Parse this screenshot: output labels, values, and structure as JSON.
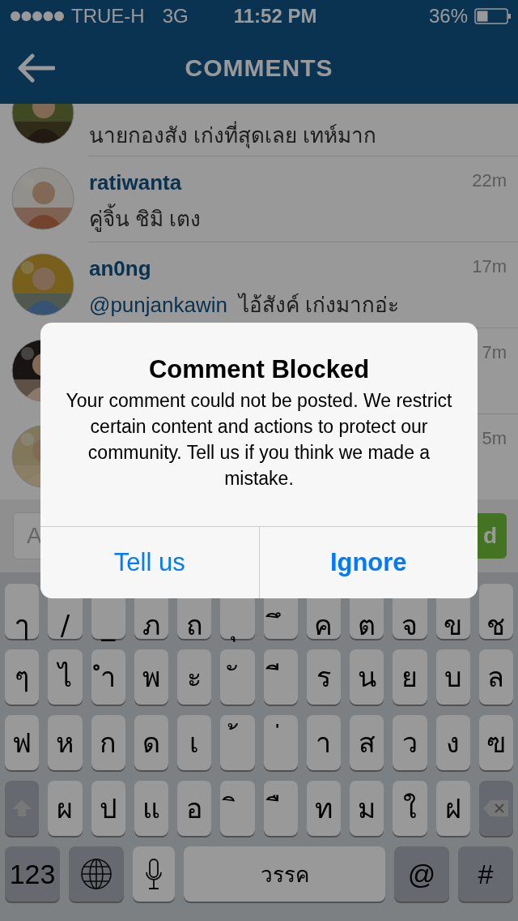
{
  "status_bar": {
    "carrier": "TRUE-H",
    "network": "3G",
    "time": "11:52 PM",
    "battery": "36%"
  },
  "header": {
    "title": "COMMENTS"
  },
  "comments": [
    {
      "text": "นายกองสัง เก่งที่สุดเลย  เทห์มาก"
    },
    {
      "username": "ratiwanta",
      "text": "คู่จิ้น ชิมิ เตง",
      "time": "22m"
    },
    {
      "username": "an0ng",
      "mention": "@punjankawin",
      "text": "ไอ้สังค์ เก่งมากอ่ะ",
      "time": "17m"
    },
    {
      "time": "7m"
    },
    {
      "time": "5m"
    }
  ],
  "composer": {
    "placeholder": "A",
    "send": "d"
  },
  "alert": {
    "title": "Comment Blocked",
    "message": "Your comment could not be posted. We restrict certain content and actions to protect our community. Tell us if you think we made a mistake.",
    "buttons": [
      {
        "label": "Tell us",
        "bold": false
      },
      {
        "label": "Ignore",
        "bold": true
      }
    ]
  },
  "keyboard": {
    "rows": [
      [
        {
          "kind": "letter",
          "label": "ๅ"
        },
        {
          "kind": "letter",
          "label": "/"
        },
        {
          "kind": "letter",
          "label": "_"
        },
        {
          "kind": "letter",
          "label": "ภ"
        },
        {
          "kind": "letter",
          "label": "ถ"
        },
        {
          "kind": "letter",
          "label": "ุ"
        },
        {
          "kind": "letter",
          "label": "ึ"
        },
        {
          "kind": "letter",
          "label": "ค"
        },
        {
          "kind": "letter",
          "label": "ต"
        },
        {
          "kind": "letter",
          "label": "จ"
        },
        {
          "kind": "letter",
          "label": "ข"
        },
        {
          "kind": "letter",
          "label": "ช"
        }
      ],
      [
        {
          "kind": "letter",
          "label": "ๆ"
        },
        {
          "kind": "letter",
          "label": "ไ"
        },
        {
          "kind": "letter",
          "label": "ำ"
        },
        {
          "kind": "letter",
          "label": "พ"
        },
        {
          "kind": "letter",
          "label": "ะ"
        },
        {
          "kind": "letter",
          "label": "ั"
        },
        {
          "kind": "letter",
          "label": "ี"
        },
        {
          "kind": "letter",
          "label": "ร"
        },
        {
          "kind": "letter",
          "label": "น"
        },
        {
          "kind": "letter",
          "label": "ย"
        },
        {
          "kind": "letter",
          "label": "บ"
        },
        {
          "kind": "letter",
          "label": "ล"
        }
      ],
      [
        {
          "kind": "letter",
          "label": "ฟ"
        },
        {
          "kind": "letter",
          "label": "ห"
        },
        {
          "kind": "letter",
          "label": "ก"
        },
        {
          "kind": "letter",
          "label": "ด"
        },
        {
          "kind": "letter",
          "label": "เ"
        },
        {
          "kind": "letter",
          "label": "้"
        },
        {
          "kind": "letter",
          "label": "่"
        },
        {
          "kind": "letter",
          "label": "า"
        },
        {
          "kind": "letter",
          "label": "ส"
        },
        {
          "kind": "letter",
          "label": "ว"
        },
        {
          "kind": "letter",
          "label": "ง"
        },
        {
          "kind": "letter",
          "label": "ฃ"
        }
      ],
      [
        {
          "kind": "shift"
        },
        {
          "kind": "letter",
          "label": "ผ"
        },
        {
          "kind": "letter",
          "label": "ป"
        },
        {
          "kind": "letter",
          "label": "แ"
        },
        {
          "kind": "letter",
          "label": "อ"
        },
        {
          "kind": "letter",
          "label": "ิ"
        },
        {
          "kind": "letter",
          "label": "ื"
        },
        {
          "kind": "letter",
          "label": "ท"
        },
        {
          "kind": "letter",
          "label": "ม"
        },
        {
          "kind": "letter",
          "label": "ใ"
        },
        {
          "kind": "letter",
          "label": "ฝ"
        },
        {
          "kind": "delete"
        }
      ]
    ],
    "bottom_row": [
      {
        "kind": "mode",
        "label": "123"
      },
      {
        "kind": "globe"
      },
      {
        "kind": "mic"
      },
      {
        "kind": "space",
        "label": "วรรค"
      },
      {
        "kind": "mode",
        "label": "@"
      },
      {
        "kind": "mode",
        "label": "#"
      }
    ]
  }
}
